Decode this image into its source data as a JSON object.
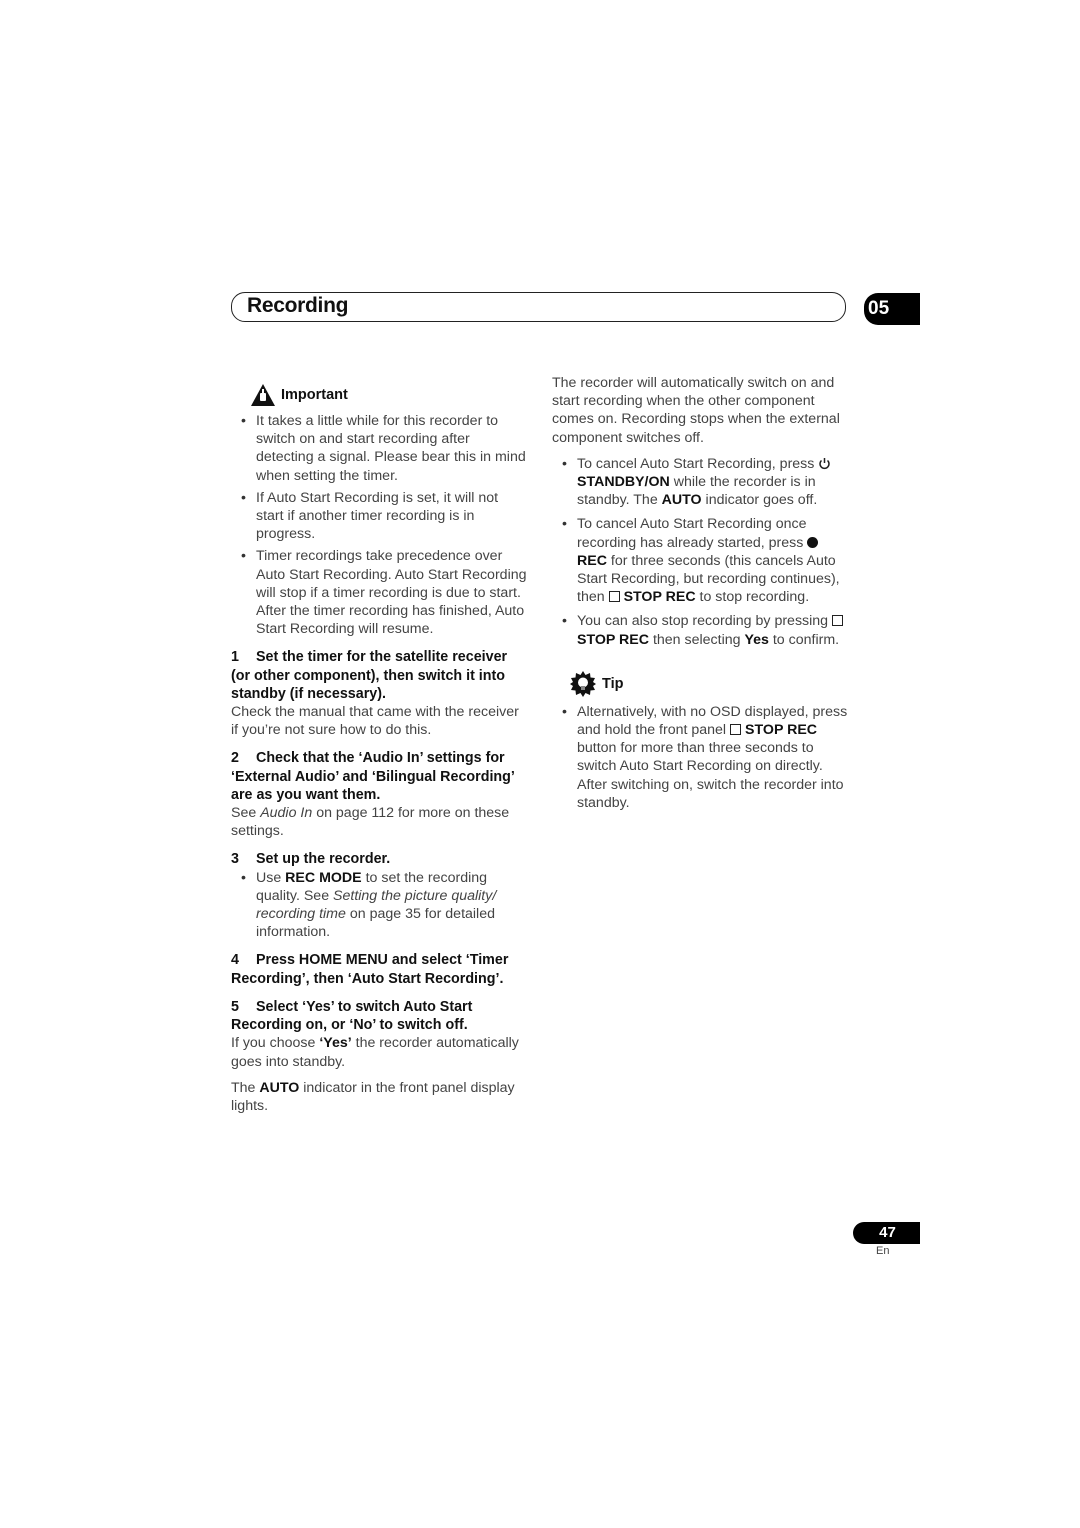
{
  "header": {
    "title": "Recording",
    "chapter": "05"
  },
  "left": {
    "important": {
      "label": "Important",
      "bullets": [
        "It takes a little while for this recorder to switch on and start recording after detecting a signal. Please bear this in mind when setting the timer.",
        "If Auto Start Recording is set, it will not start if another timer recording is in progress.",
        "Timer recordings take precedence over Auto Start Recording. Auto Start Recording will stop if a timer recording is due to start. After the timer recording has finished, Auto Start Recording will resume."
      ]
    },
    "steps": [
      {
        "num": "1",
        "heading": "Set the timer for the satellite receiver (or other component), then switch it into standby (if necessary).",
        "body": "Check the manual that came with the receiver if you’re not sure how to do this."
      },
      {
        "num": "2",
        "heading": "Check that the ‘Audio In’ settings for ‘External Audio’ and ‘Bilingual Recording’ are as you want them.",
        "body_pre": "See ",
        "body_italic": "Audio In",
        "body_post": " on page 112 for more on these settings."
      },
      {
        "num": "3",
        "heading": "Set up the recorder.",
        "bullet_pre": "Use ",
        "bullet_bold": "REC MODE",
        "bullet_mid": " to set the recording quality. See ",
        "bullet_italic": "Setting the picture quality/ recording time",
        "bullet_post": " on page 35 for detailed information."
      },
      {
        "num": "4",
        "heading": "Press HOME MENU and select ‘Timer Recording’, then ‘Auto Start Recording’."
      },
      {
        "num": "5",
        "heading": "Select ‘Yes’ to switch Auto Start Recording on, or ‘No’ to switch off.",
        "body_pre": "If you choose ",
        "body_bold": "‘Yes’",
        "body_post": " the recorder automatically goes into standby.",
        "body2_pre": "The ",
        "body2_bold": "AUTO",
        "body2_post": " indicator in the front panel display lights."
      }
    ]
  },
  "right": {
    "intro": "The recorder will automatically switch on and start recording when the other component comes on. Recording stops when the external component switches off.",
    "bullets": [
      {
        "pre": "To cancel Auto Start Recording, press ",
        "icon": "power-icon",
        "bold1": "STANDBY/ON",
        "mid": " while the recorder is in standby. The ",
        "bold2": "AUTO",
        "post": " indicator goes off."
      },
      {
        "pre": "To cancel Auto Start Recording once recording has already started, press",
        "icon": "record-dot-icon",
        "bold1": "REC",
        "mid": " for three seconds (this cancels Auto Start Recording, but recording continues), then ",
        "icon2": "stop-square-icon",
        "bold2": "STOP REC",
        "post": " to stop recording."
      },
      {
        "pre": "You can also stop recording by pressing ",
        "icon": "stop-square-icon",
        "bold1": "STOP REC",
        "mid": " then selecting ",
        "bold2": "Yes",
        "post": " to confirm."
      }
    ],
    "tip": {
      "label": "Tip",
      "pre": "Alternatively, with no OSD displayed, press and hold the front panel ",
      "icon": "stop-square-icon",
      "bold": "STOP REC",
      "post": " button for more than three seconds to switch Auto Start Recording on directly. After switching on, switch the recorder into standby."
    }
  },
  "footer": {
    "page_number": "47",
    "language": "En"
  }
}
